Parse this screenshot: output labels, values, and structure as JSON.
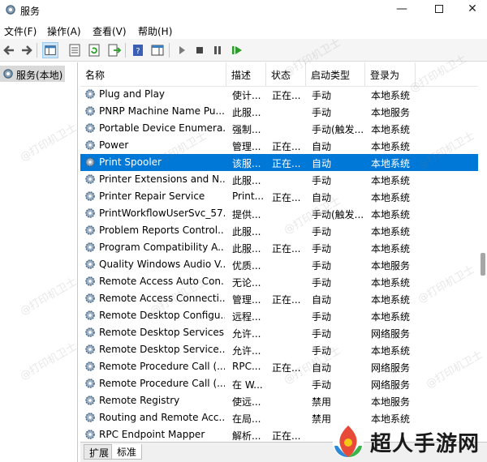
{
  "window": {
    "title": "服务",
    "minimize": "—",
    "close": "✕"
  },
  "menu": [
    "文件(F)",
    "操作(A)",
    "查看(V)",
    "帮助(H)"
  ],
  "tree": {
    "root_label": "服务(本地)"
  },
  "columns": [
    "名称",
    "描述",
    "状态",
    "启动类型",
    "登录为"
  ],
  "sort_indicator": "^",
  "rows": [
    {
      "name": "Plug and Play",
      "desc": "使计...",
      "status": "正在...",
      "start": "手动",
      "logon": "本地系统"
    },
    {
      "name": "PNRP Machine Name Pu...",
      "desc": "此服...",
      "status": "",
      "start": "手动",
      "logon": "本地服务"
    },
    {
      "name": "Portable Device Enumera...",
      "desc": "强制...",
      "status": "",
      "start": "手动(触发...",
      "logon": "本地系统"
    },
    {
      "name": "Power",
      "desc": "管理...",
      "status": "正在...",
      "start": "自动",
      "logon": "本地系统"
    },
    {
      "name": "Print Spooler",
      "desc": "该服...",
      "status": "正在...",
      "start": "自动",
      "logon": "本地系统",
      "selected": true
    },
    {
      "name": "Printer Extensions and N...",
      "desc": "此服...",
      "status": "",
      "start": "手动",
      "logon": "本地系统"
    },
    {
      "name": "Printer Repair Service",
      "desc": "Print...",
      "status": "正在...",
      "start": "自动",
      "logon": "本地系统"
    },
    {
      "name": "PrintWorkflowUserSvc_57...",
      "desc": "提供...",
      "status": "",
      "start": "手动(触发...",
      "logon": "本地系统"
    },
    {
      "name": "Problem Reports Control...",
      "desc": "此服...",
      "status": "",
      "start": "手动",
      "logon": "本地系统"
    },
    {
      "name": "Program Compatibility A...",
      "desc": "此服...",
      "status": "正在...",
      "start": "手动",
      "logon": "本地系统"
    },
    {
      "name": "Quality Windows Audio V...",
      "desc": "优质...",
      "status": "",
      "start": "手动",
      "logon": "本地服务"
    },
    {
      "name": "Remote Access Auto Con...",
      "desc": "无论...",
      "status": "",
      "start": "手动",
      "logon": "本地系统"
    },
    {
      "name": "Remote Access Connecti...",
      "desc": "管理...",
      "status": "正在...",
      "start": "自动",
      "logon": "本地系统"
    },
    {
      "name": "Remote Desktop Configu...",
      "desc": "远程...",
      "status": "",
      "start": "手动",
      "logon": "本地系统"
    },
    {
      "name": "Remote Desktop Services",
      "desc": "允许...",
      "status": "",
      "start": "手动",
      "logon": "网络服务"
    },
    {
      "name": "Remote Desktop Service...",
      "desc": "允许...",
      "status": "",
      "start": "手动",
      "logon": "本地系统"
    },
    {
      "name": "Remote Procedure Call (...",
      "desc": "RPC...",
      "status": "正在...",
      "start": "自动",
      "logon": "网络服务"
    },
    {
      "name": "Remote Procedure Call (...",
      "desc": "在 W...",
      "status": "",
      "start": "手动",
      "logon": "网络服务"
    },
    {
      "name": "Remote Registry",
      "desc": "使远...",
      "status": "",
      "start": "禁用",
      "logon": "本地服务"
    },
    {
      "name": "Routing and Remote Acc...",
      "desc": "在局...",
      "status": "",
      "start": "禁用",
      "logon": "本地系统"
    },
    {
      "name": "RPC Endpoint Mapper",
      "desc": "解析...",
      "status": "正在...",
      "start": "",
      "logon": ""
    }
  ],
  "tabs": {
    "extended": "扩展",
    "standard": "标准"
  },
  "watermark": "@打印机卫士",
  "logo": {
    "text": "超人手游网"
  },
  "colors": {
    "selection": "#0078d7",
    "toolbar_bg": "#f5f5f5",
    "tree_selected_bg": "#d9d9d9"
  }
}
